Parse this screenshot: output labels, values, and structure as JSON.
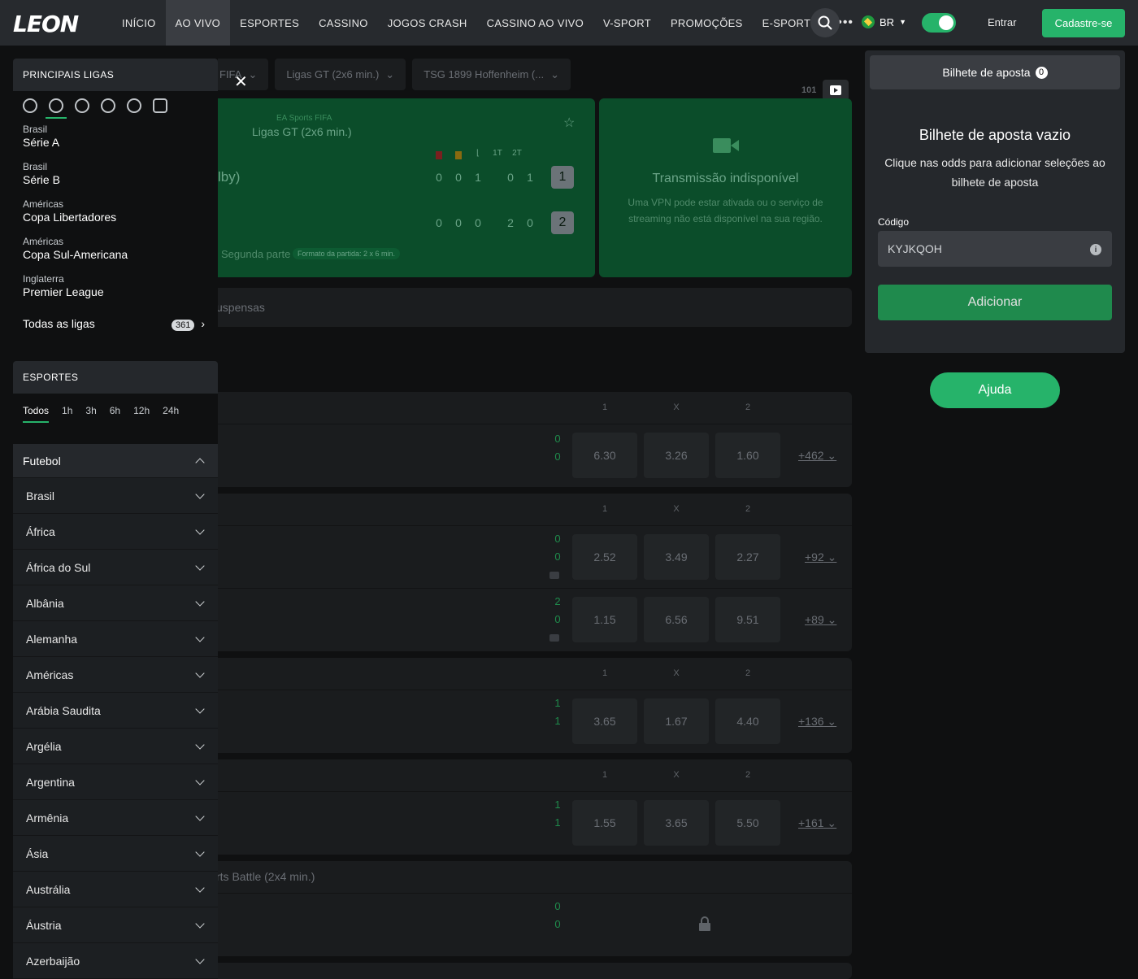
{
  "header": {
    "logo": "LEON",
    "nav": [
      "INÍCIO",
      "AO VIVO",
      "ESPORTES",
      "CASSINO",
      "JOGOS CRASH",
      "CASSINO AO VIVO",
      "V-SPORT",
      "PROMOÇÕES",
      "E-SPORTS"
    ],
    "more": "•••",
    "lang": "BR",
    "login": "Entrar",
    "signup": "Cadastre-se"
  },
  "filters": {
    "chips": [
      "FIFA",
      "Ligas GT (2x6 min.)",
      "TSG 1899 Hoffenheim (..."
    ]
  },
  "match": {
    "league": "EA Sports FIFA",
    "competition": "Ligas GT (2x6 min.)",
    "team1_partial": "lby)",
    "cols": [
      "",
      "",
      "",
      "1T",
      "2T"
    ],
    "row1": [
      "0",
      "0",
      "1",
      "0",
      "1"
    ],
    "row2": [
      "0",
      "0",
      "0",
      "2",
      "0"
    ],
    "score1": "1",
    "score2": "2",
    "period": "Segunda parte",
    "format": "Formato da partida: 2 x 6 min."
  },
  "stream": {
    "title": "Transmissão indisponível",
    "text": "Uma VPN pode estar ativada ou o serviço de streaming não está disponível na sua região."
  },
  "suspended_label": "uspensas",
  "events": {
    "cols": [
      "1",
      "X",
      "2"
    ],
    "blocks": [
      {
        "rows": [
          {
            "s1": "0",
            "s2": "0",
            "o": [
              "6.30",
              "3.26",
              "1.60"
            ],
            "more": "+462"
          }
        ]
      },
      {
        "rows": [
          {
            "s1": "0",
            "s2": "0",
            "o": [
              "2.52",
              "3.49",
              "2.27"
            ],
            "more": "+92"
          },
          {
            "s1": "2",
            "s2": "0",
            "o": [
              "1.15",
              "6.56",
              "9.51"
            ],
            "more": "+89"
          }
        ]
      },
      {
        "rows": [
          {
            "s1": "1",
            "s2": "1",
            "o": [
              "3.65",
              "1.67",
              "4.40"
            ],
            "more": "+136"
          }
        ]
      },
      {
        "rows": [
          {
            "s1": "1",
            "s2": "1",
            "o": [
              "1.55",
              "3.65",
              "5.50"
            ],
            "more": "+161"
          }
        ]
      }
    ],
    "locked_title": "rts Battle (2x4 min.)",
    "locked_s1": "0",
    "locked_s2": "0"
  },
  "sidebar": {
    "top_title": "PRINCIPAIS LIGAS",
    "leagues": [
      {
        "c": "Brasil",
        "n": "Série A"
      },
      {
        "c": "Brasil",
        "n": "Série B"
      },
      {
        "c": "Américas",
        "n": "Copa Libertadores"
      },
      {
        "c": "Américas",
        "n": "Copa Sul-Americana"
      },
      {
        "c": "Inglaterra",
        "n": "Premier League"
      }
    ],
    "all_leagues": "Todas as ligas",
    "all_count": "361",
    "sports_title": "ESPORTES",
    "time_filters": [
      "Todos",
      "1h",
      "3h",
      "6h",
      "12h",
      "24h"
    ],
    "sport_head": "Futebol",
    "countries": [
      "Brasil",
      "África",
      "África do Sul",
      "Albânia",
      "Alemanha",
      "Américas",
      "Arábia Saudita",
      "Argélia",
      "Argentina",
      "Armênia",
      "Ásia",
      "Austrália",
      "Áustria",
      "Azerbaijão"
    ]
  },
  "betslip": {
    "tab": "Bilhete de aposta",
    "count": "0",
    "empty_title": "Bilhete de aposta vazio",
    "empty_text": "Clique nas odds para adicionar seleções ao bilhete de aposta",
    "code_label": "Código",
    "code_value": "KYJKQOH",
    "add": "Adicionar"
  },
  "help": "Ajuda"
}
